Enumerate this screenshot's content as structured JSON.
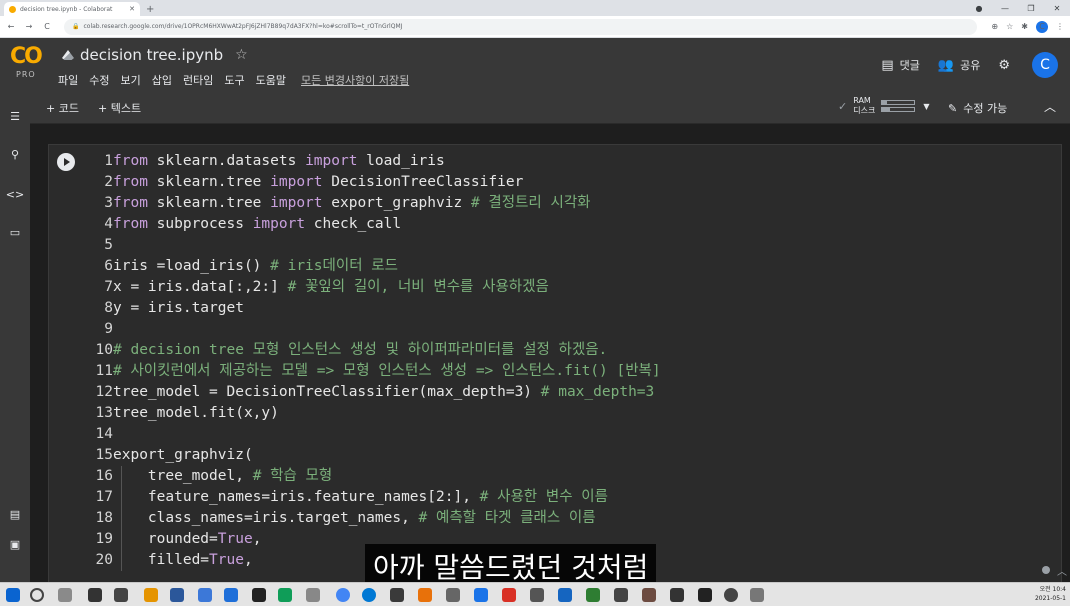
{
  "browser": {
    "tab_title": "decision tree.ipynb - Colaborat",
    "new_tab": "+",
    "url": "colab.research.google.com/drive/1OPRcM6HXWwAt2pFJ6jZHl7B89q7dA3FX?hl=ko#scrollTo=t_rOTnGrlQMJ",
    "window_controls": [
      "●",
      "—",
      "❐",
      "✕"
    ]
  },
  "colab": {
    "logo_text": "CO",
    "pro_badge": "PRO",
    "notebook_title": "decision tree.ipynb",
    "menu": [
      "파일",
      "수정",
      "보기",
      "삽입",
      "런타임",
      "도구",
      "도움말"
    ],
    "save_status": "모든 변경사항이 저장됨",
    "comment_label": "댓글",
    "share_label": "공유",
    "avatar_letter": "C",
    "accent_color": "#f9ab00"
  },
  "toolbar": {
    "add_code": "+ 코드",
    "add_text": "+ 텍스트",
    "ram_label": "RAM",
    "disk_label": "디스크",
    "edit_mode": "수정 가능",
    "ram_usage": 0.15,
    "disk_usage": 0.25
  },
  "code_lines": [
    {
      "n": "1",
      "segs": [
        [
          "kw",
          "from"
        ],
        [
          "t",
          " sklearn.datasets "
        ],
        [
          "kw",
          "import"
        ],
        [
          "t",
          " load_iris"
        ]
      ]
    },
    {
      "n": "2",
      "segs": [
        [
          "kw",
          "from"
        ],
        [
          "t",
          " sklearn.tree "
        ],
        [
          "kw",
          "import"
        ],
        [
          "t",
          " DecisionTreeClassifier"
        ]
      ]
    },
    {
      "n": "3",
      "segs": [
        [
          "kw",
          "from"
        ],
        [
          "t",
          " sklearn.tree "
        ],
        [
          "kw",
          "import"
        ],
        [
          "t",
          " export_graphviz "
        ],
        [
          "cm",
          "# 결정트리 시각화"
        ]
      ]
    },
    {
      "n": "4",
      "segs": [
        [
          "kw",
          "from"
        ],
        [
          "t",
          " subprocess "
        ],
        [
          "kw",
          "import"
        ],
        [
          "t",
          " check_call"
        ]
      ]
    },
    {
      "n": "5",
      "segs": []
    },
    {
      "n": "6",
      "segs": [
        [
          "t",
          "iris =load_iris() "
        ],
        [
          "cm",
          "# iris데이터 로드"
        ]
      ]
    },
    {
      "n": "7",
      "segs": [
        [
          "t",
          "x = iris.data[:,2:] "
        ],
        [
          "cm",
          "# 꽃잎의 길이, 너비 변수를 사용하겠음"
        ]
      ]
    },
    {
      "n": "8",
      "segs": [
        [
          "t",
          "y = iris.target"
        ]
      ]
    },
    {
      "n": "9",
      "segs": []
    },
    {
      "n": "10",
      "segs": [
        [
          "cm",
          "# decision tree 모형 인스턴스 생성 및 하이퍼파라미터를 설정 하겠음."
        ]
      ]
    },
    {
      "n": "11",
      "segs": [
        [
          "cm",
          "# 사이킷런에서 제공하는 모델 => 모형 인스턴스 생성 => 인스턴스.fit() [반복]"
        ]
      ]
    },
    {
      "n": "12",
      "segs": [
        [
          "t",
          "tree_model = DecisionTreeClassifier(max_depth=3) "
        ],
        [
          "cm",
          "# max_depth=3"
        ]
      ]
    },
    {
      "n": "13",
      "segs": [
        [
          "t",
          "tree_model.fit(x,y)"
        ]
      ]
    },
    {
      "n": "14",
      "segs": []
    },
    {
      "n": "15",
      "segs": [
        [
          "t",
          "export_graphviz("
        ]
      ]
    },
    {
      "n": "16",
      "indent": true,
      "segs": [
        [
          "t",
          "    tree_model, "
        ],
        [
          "cm",
          "# 학습 모형"
        ]
      ]
    },
    {
      "n": "17",
      "indent": true,
      "segs": [
        [
          "t",
          "    feature_names=iris.feature_names[2:], "
        ],
        [
          "cm",
          "# 사용한 변수 이름"
        ]
      ]
    },
    {
      "n": "18",
      "indent": true,
      "segs": [
        [
          "t",
          "    class_names=iris.target_names, "
        ],
        [
          "cm",
          "# 예측할 타겟 클래스 이름"
        ]
      ]
    },
    {
      "n": "19",
      "indent": true,
      "segs": [
        [
          "t",
          "    rounded="
        ],
        [
          "kw",
          "True"
        ],
        [
          "t",
          ","
        ]
      ]
    },
    {
      "n": "20",
      "indent": true,
      "segs": [
        [
          "t",
          "    filled="
        ],
        [
          "kw",
          "True"
        ],
        [
          "t",
          ","
        ]
      ]
    }
  ],
  "subtitle": "아까 말씀드렸던 것처럼",
  "clock": {
    "time": "오전 10:4",
    "date": "2021-05-1"
  }
}
